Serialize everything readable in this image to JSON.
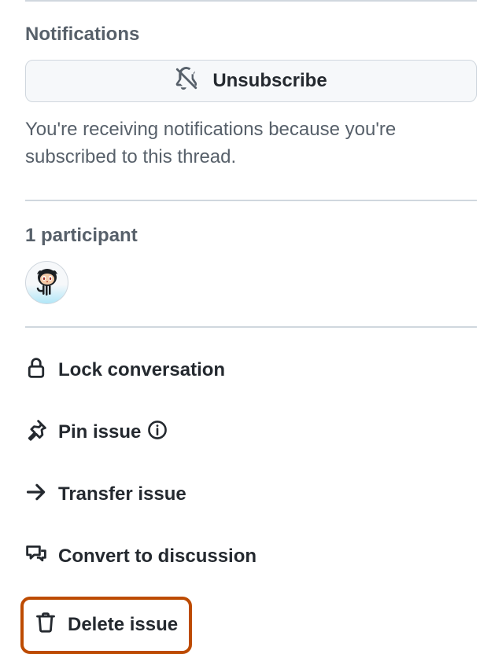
{
  "notifications": {
    "title": "Notifications",
    "unsubscribe_label": "Unsubscribe",
    "note": "You're receiving notifications because you're subscribed to this thread."
  },
  "participants": {
    "title": "1 participant"
  },
  "actions": {
    "lock": "Lock conversation",
    "pin": "Pin issue",
    "transfer": "Transfer issue",
    "convert": "Convert to discussion",
    "delete": "Delete issue"
  }
}
